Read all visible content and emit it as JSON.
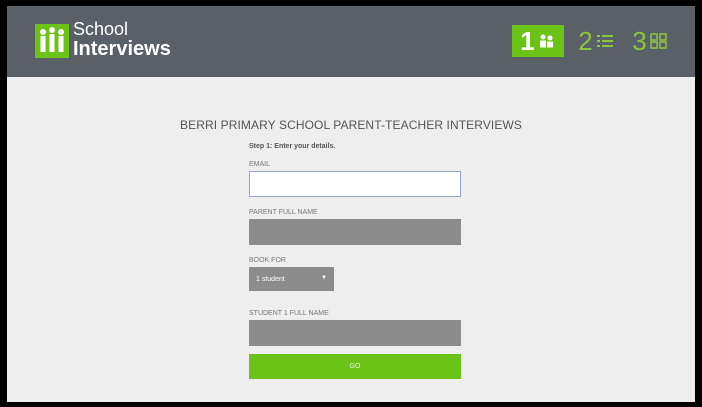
{
  "logo": {
    "line1": "School",
    "line2": "Interviews",
    "icon": "school-people-icon"
  },
  "steps": [
    {
      "number": "1",
      "icon": "people-icon",
      "state": "active"
    },
    {
      "number": "2",
      "icon": "list-icon",
      "state": "inactive"
    },
    {
      "number": "3",
      "icon": "grid-icon",
      "state": "inactive"
    }
  ],
  "page": {
    "title": "BERRI PRIMARY SCHOOL PARENT-TEACHER INTERVIEWS",
    "subtitle": "Step 1: Enter your details."
  },
  "form": {
    "email_label": "EMAIL",
    "email_value": "",
    "parent_label": "PARENT FULL NAME",
    "parent_value": "",
    "book_for_label": "BOOK FOR",
    "book_for_value": "1 student",
    "student_label": "STUDENT 1 FULL NAME",
    "student_value": "",
    "submit_label": "GO"
  },
  "colors": {
    "accent": "#6cc317",
    "header": "#5a6068",
    "background": "#eeeeee",
    "field_disabled": "#8c8c8c"
  }
}
